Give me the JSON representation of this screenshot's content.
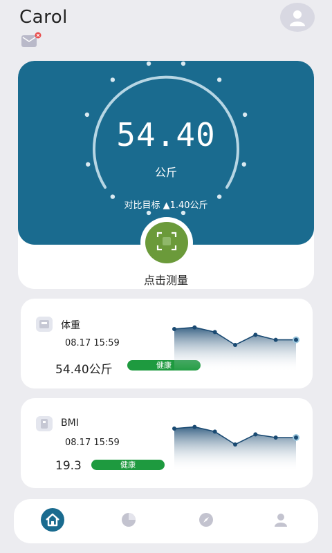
{
  "header": {
    "user_name": "Carol",
    "avatar_icon": "user-avatar-icon",
    "mail_icon": "mail-icon"
  },
  "hero": {
    "weight_value": "54.40",
    "weight_unit": "公斤",
    "compare_label": "对比目标 ▲1.40公斤",
    "measure_label": "点击测量",
    "measure_icon": "scan-icon",
    "colors": {
      "panel": "#1a6b8f",
      "button": "#6b9a3a"
    }
  },
  "metrics": [
    {
      "title": "体重",
      "icon": "weight-scale-icon",
      "time": "08.17 15:59",
      "value": "54.40公斤",
      "status": "健康",
      "trend": [
        0.6,
        0.72,
        0.38,
        -0.55,
        0.18,
        -0.18,
        -0.18
      ]
    },
    {
      "title": "BMI",
      "icon": "bmi-icon",
      "time": "08.17 15:59",
      "value": "19.3",
      "status": "健康",
      "trend": [
        0.6,
        0.72,
        0.38,
        -0.55,
        0.18,
        -0.05,
        -0.05
      ]
    }
  ],
  "tabbar": {
    "items": [
      {
        "icon": "home-icon",
        "active": true
      },
      {
        "icon": "pie-chart-icon",
        "active": false
      },
      {
        "icon": "compass-icon",
        "active": false
      },
      {
        "icon": "profile-icon",
        "active": false
      }
    ],
    "accent_color": "#1a6b8f"
  }
}
